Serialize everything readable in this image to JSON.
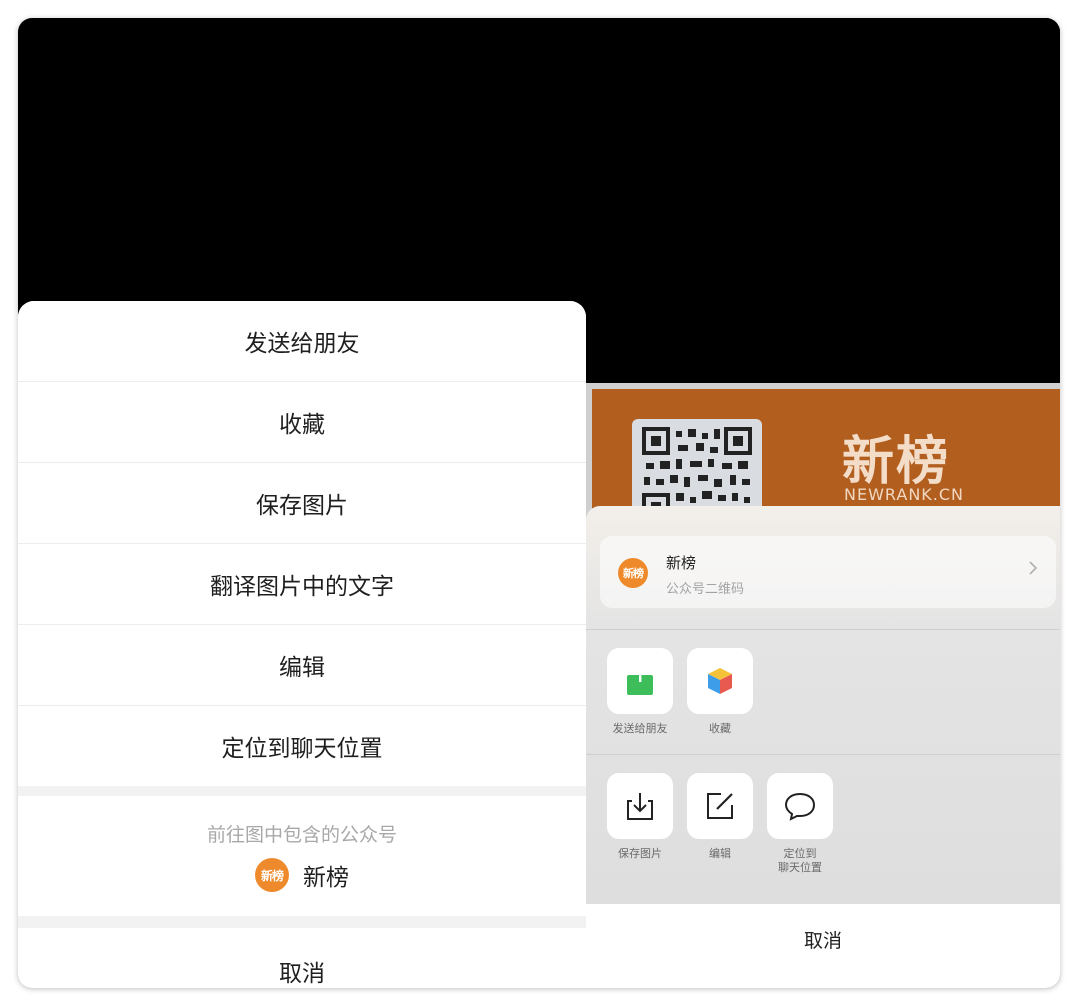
{
  "left_sheet": {
    "items": [
      {
        "label": "发送给朋友"
      },
      {
        "label": "收藏"
      },
      {
        "label": "保存图片"
      },
      {
        "label": "翻译图片中的文字"
      },
      {
        "label": "编辑"
      },
      {
        "label": "定位到聊天位置"
      }
    ],
    "official_account": {
      "hint": "前往图中包含的公众号",
      "name": "新榜",
      "avatar_text": "新榜"
    },
    "cancel": "取消"
  },
  "right_panel": {
    "poster": {
      "brand": "新榜",
      "url": "NEWRANK.CN"
    },
    "contact_card": {
      "name": "新榜",
      "subtitle": "公众号二维码",
      "avatar_text": "新榜"
    },
    "actions_row1": [
      {
        "label": "发送给朋友",
        "icon": "share-up-icon"
      },
      {
        "label": "收藏",
        "icon": "cube-favorite-icon"
      }
    ],
    "actions_row2": [
      {
        "label": "保存图片",
        "icon": "download-icon"
      },
      {
        "label": "编辑",
        "icon": "edit-icon"
      },
      {
        "label": "定位到\n聊天位置",
        "icon": "chat-bubble-icon"
      }
    ],
    "cancel": "取消"
  },
  "colors": {
    "brand_orange": "#ef8a2c",
    "poster_bg": "#b25e1f",
    "share_green": "#3dbe5a"
  }
}
